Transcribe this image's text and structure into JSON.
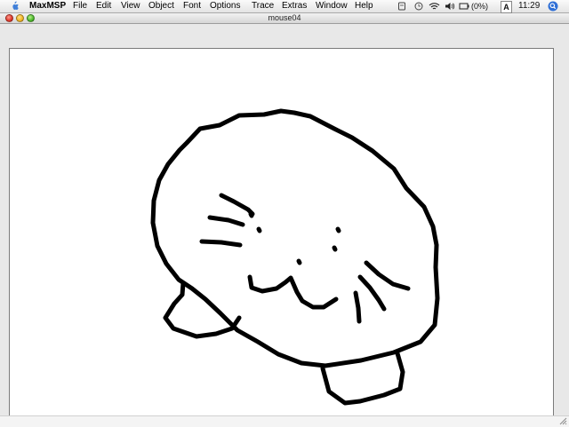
{
  "menubar": {
    "app_name": "MaxMSP",
    "items": [
      "File",
      "Edit",
      "View",
      "Object",
      "Font",
      "Options",
      "Trace",
      "Extras",
      "Window",
      "Help"
    ],
    "battery": "(0%)",
    "input_menu": "A",
    "clock": "11:29"
  },
  "window": {
    "title": "mouse04"
  },
  "icons": {
    "apple": "apple-icon",
    "spotlight": "spotlight-icon",
    "wifi": "wifi-icon",
    "volume": "volume-icon"
  },
  "colors": {
    "stroke": "#000000",
    "canvas": "#ffffff"
  }
}
